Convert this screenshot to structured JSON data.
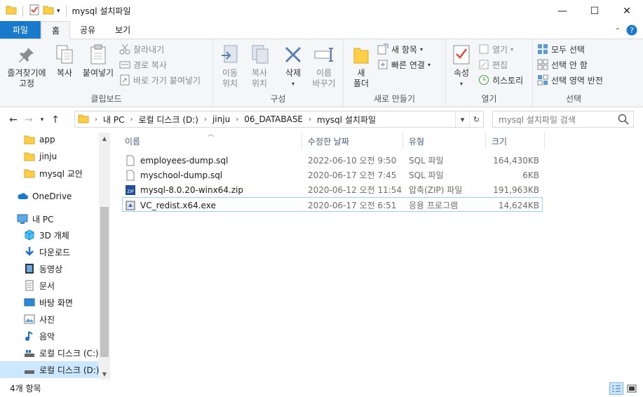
{
  "window": {
    "title": "mysql 설치파일",
    "minimize": "—",
    "maximize": "☐",
    "close": "✕"
  },
  "tabs": [
    "파일",
    "홈",
    "공유",
    "보기"
  ],
  "ribbon": {
    "clipboard": {
      "label": "클립보드",
      "pin": "즐겨찾기에\n고정",
      "copy": "복사",
      "paste": "붙여넣기",
      "cut": "잘라내기",
      "copy_path": "경로 복사",
      "paste_shortcut": "바로 가기 붙여넣기"
    },
    "organize": {
      "label": "구성",
      "move_to": "이동\n위치",
      "copy_to": "복사\n위치",
      "delete": "삭제",
      "rename": "이름\n바꾸기"
    },
    "new": {
      "label": "새로 만들기",
      "new_folder": "새\n폴더",
      "new_item": "새 항목",
      "easy_access": "빠른 연결"
    },
    "open": {
      "label": "열기",
      "properties": "속성",
      "open": "열기",
      "edit": "편집",
      "history": "히스토리"
    },
    "select": {
      "label": "선택",
      "select_all": "모두 선택",
      "select_none": "선택 안 함",
      "invert": "선택 영역 반전"
    }
  },
  "address": {
    "crumbs": [
      "내 PC",
      "로컬 디스크 (D:)",
      "jinju",
      "06_DATABASE",
      "mysql 설치파일"
    ],
    "search_placeholder": "mysql 설치파일 검색"
  },
  "nav": {
    "items": [
      {
        "label": "app",
        "icon": "folder-icon"
      },
      {
        "label": "jinju",
        "icon": "folder-icon"
      },
      {
        "label": "mysql 교안",
        "icon": "folder-icon"
      },
      {
        "label": "OneDrive",
        "icon": "cloud-icon"
      },
      {
        "label": "내 PC",
        "icon": "pc-icon"
      },
      {
        "label": "3D 개체",
        "icon": "cube-icon"
      },
      {
        "label": "다운로드",
        "icon": "download-icon"
      },
      {
        "label": "동영상",
        "icon": "video-icon"
      },
      {
        "label": "문서",
        "icon": "document-icon"
      },
      {
        "label": "바탕 화면",
        "icon": "desktop-icon"
      },
      {
        "label": "사진",
        "icon": "picture-icon"
      },
      {
        "label": "음악",
        "icon": "music-icon"
      },
      {
        "label": "로컬 디스크 (C:)",
        "icon": "drive-icon"
      },
      {
        "label": "로컬 디스크 (D:)",
        "icon": "drive-icon"
      }
    ]
  },
  "columns": {
    "name": "이름",
    "modified": "수정한 날짜",
    "type": "유형",
    "size": "크기"
  },
  "files": [
    {
      "name": "employees-dump.sql",
      "modified": "2022-06-10 오전 9:50",
      "type": "SQL 파일",
      "size": "164,430KB",
      "icon": "sql-file-icon"
    },
    {
      "name": "myschool-dump.sql",
      "modified": "2020-06-17 오전 7:45",
      "type": "SQL 파일",
      "size": "6KB",
      "icon": "sql-file-icon"
    },
    {
      "name": "mysql-8.0.20-winx64.zip",
      "modified": "2020-06-12 오전 11:54",
      "type": "압축(ZIP) 파일",
      "size": "191,963KB",
      "icon": "zip-file-icon"
    },
    {
      "name": "VC_redist.x64.exe",
      "modified": "2020-06-17 오전 6:51",
      "type": "응용 프로그램",
      "size": "14,624KB",
      "icon": "installer-icon"
    }
  ],
  "status": {
    "count": "4개 항목"
  },
  "colors": {
    "accent": "#1979ca",
    "selection": "#cce8ff",
    "folder": "#ffcf48"
  }
}
